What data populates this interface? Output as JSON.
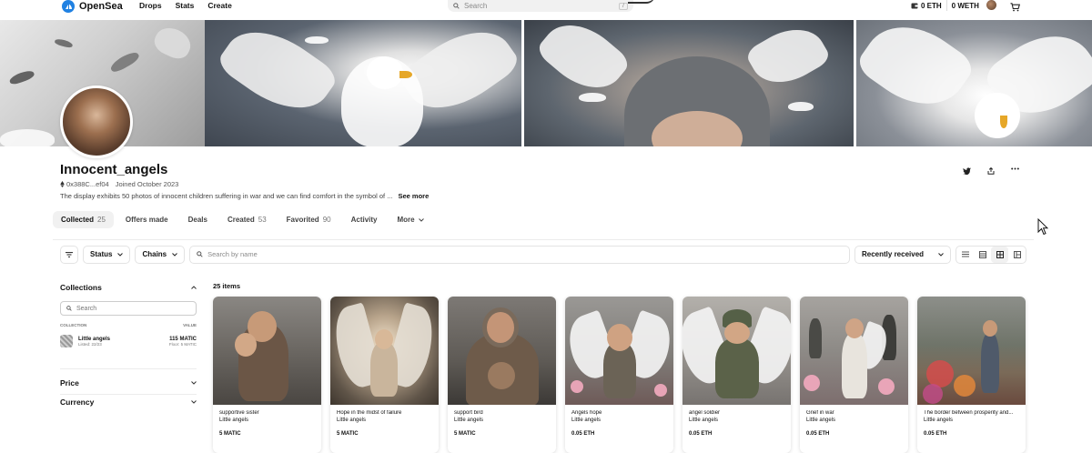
{
  "nav": {
    "brand": "OpenSea",
    "links": [
      "Drops",
      "Stats",
      "Create"
    ],
    "search_placeholder": "Search",
    "search_shortcut": "/",
    "balance_eth": "0 ETH",
    "balance_weth": "0 WETH"
  },
  "profile": {
    "name": "Innocent_angels",
    "address": "0x388C...ef04",
    "joined": "Joined October 2023",
    "description": "The display exhibits 50 photos of innocent children suffering in war and we can find comfort in the symbol of ...",
    "see_more": "See more"
  },
  "tabs": [
    {
      "label": "Collected",
      "count": "25"
    },
    {
      "label": "Offers made",
      "count": ""
    },
    {
      "label": "Deals",
      "count": ""
    },
    {
      "label": "Created",
      "count": "53"
    },
    {
      "label": "Favorited",
      "count": "90"
    },
    {
      "label": "Activity",
      "count": ""
    },
    {
      "label": "More",
      "count": ""
    }
  ],
  "filters": {
    "status": "Status",
    "chains": "Chains",
    "search_placeholder": "Search by name",
    "sort": "Recently received"
  },
  "sidebar": {
    "collections_title": "Collections",
    "search_placeholder": "Search",
    "col_collection": "COLLECTION",
    "col_value": "VALUE",
    "collection": {
      "name": "Little angels",
      "listed": "Listed: 22/23",
      "value": "115 MATIC",
      "floor": "Floor: 5 MATIC"
    },
    "price_title": "Price",
    "currency_title": "Currency"
  },
  "items_count": "25 items",
  "cards": [
    {
      "title": "supportive sister",
      "collection": "Little angels",
      "price": "5 MATIC"
    },
    {
      "title": "Hope in the midst of failure",
      "collection": "Little angels",
      "price": "5 MATIC"
    },
    {
      "title": "support bird",
      "collection": "Little angels",
      "price": "5 MATIC"
    },
    {
      "title": "Angels hope",
      "collection": "Little angels",
      "price": "0.05 ETH"
    },
    {
      "title": "angel soldier",
      "collection": "Little angels",
      "price": "0.05 ETH"
    },
    {
      "title": "Grief in war",
      "collection": "Little angels",
      "price": "0.05 ETH"
    },
    {
      "title": "The border between prosperity and...",
      "collection": "Little angels",
      "price": "0.05 ETH"
    }
  ]
}
